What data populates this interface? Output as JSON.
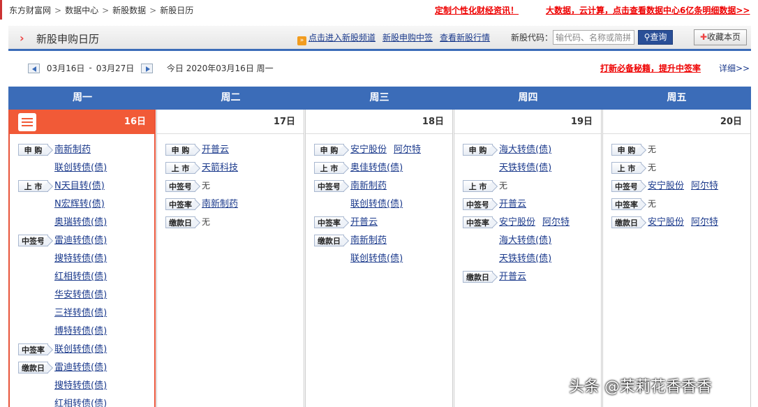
{
  "breadcrumb": [
    "东方财富网",
    "数据中心",
    "新股数据",
    "新股日历"
  ],
  "breadcrumb_sep": ">",
  "top_links": [
    "定制个性化财经资讯！",
    "大数据，云计算，点击查看数据中心6亿条明细数据>>"
  ],
  "header": {
    "title": "新股申购日历",
    "links": [
      "点击进入新股频道",
      "新股申购中签",
      "查看新股行情"
    ],
    "code_label": "新股代码：",
    "search_placeholder": "输代码、名称或简拼",
    "query_label": "查询",
    "favorite_label": "收藏本页"
  },
  "nav": {
    "range_start": "03月16日",
    "range_dash": "-",
    "range_end": "03月27日",
    "today_text": "今日 2020年03月16日 周一",
    "promo": "打新必备秘籍，提升中签率",
    "detail": "详细>>"
  },
  "colors": {
    "accent": "#3b6cb8",
    "today": "#f15a37",
    "alert": "#e00000"
  },
  "tag_labels": {
    "sg": "申 购",
    "ss": "上 市",
    "zqh": "中签号",
    "zql": "中签率",
    "jkr": "缴款日"
  },
  "none_text": "无",
  "days": [
    {
      "weekday": "周一",
      "date": "16日",
      "rows": [
        {
          "tag": "申 购",
          "items": [
            "南新制药"
          ]
        },
        {
          "tag": "",
          "items": [
            "联创转债(债)"
          ]
        },
        {
          "tag": "上 市",
          "items": [
            "N天目转(债)"
          ]
        },
        {
          "tag": "",
          "items": [
            "N宏辉转(债)"
          ]
        },
        {
          "tag": "",
          "items": [
            "奥瑞转债(债)"
          ]
        },
        {
          "tag": "中签号",
          "items": [
            "雷迪转债(债)"
          ]
        },
        {
          "tag": "",
          "items": [
            "搜特转债(债)"
          ]
        },
        {
          "tag": "",
          "items": [
            "红相转债(债)"
          ]
        },
        {
          "tag": "",
          "items": [
            "华安转债(债)"
          ]
        },
        {
          "tag": "",
          "items": [
            "三祥转债(债)"
          ]
        },
        {
          "tag": "",
          "items": [
            "博特转债(债)"
          ]
        },
        {
          "tag": "中签率",
          "items": [
            "联创转债(债)"
          ]
        },
        {
          "tag": "缴款日",
          "items": [
            "雷迪转债(债)"
          ]
        },
        {
          "tag": "",
          "items": [
            "搜特转债(债)"
          ]
        },
        {
          "tag": "",
          "items": [
            "红相转债(债)"
          ]
        }
      ]
    },
    {
      "weekday": "周二",
      "date": "17日",
      "rows": [
        {
          "tag": "申 购",
          "items": [
            "开普云"
          ]
        },
        {
          "tag": "上 市",
          "items": [
            "天箭科技"
          ]
        },
        {
          "tag": "中签号",
          "items": [],
          "none": true
        },
        {
          "tag": "中签率",
          "items": [
            "南新制药"
          ]
        },
        {
          "tag": "缴款日",
          "items": [],
          "none": true
        }
      ]
    },
    {
      "weekday": "周三",
      "date": "18日",
      "rows": [
        {
          "tag": "申 购",
          "items": [
            "安宁股份",
            "阿尔特"
          ]
        },
        {
          "tag": "上 市",
          "items": [
            "奥佳转债(债)"
          ]
        },
        {
          "tag": "中签号",
          "items": [
            "南新制药"
          ]
        },
        {
          "tag": "",
          "items": [
            "联创转债(债)"
          ]
        },
        {
          "tag": "中签率",
          "items": [
            "开普云"
          ]
        },
        {
          "tag": "缴款日",
          "items": [
            "南新制药"
          ]
        },
        {
          "tag": "",
          "items": [
            "联创转债(债)"
          ]
        }
      ]
    },
    {
      "weekday": "周四",
      "date": "19日",
      "rows": [
        {
          "tag": "申 购",
          "items": [
            "海大转债(债)"
          ]
        },
        {
          "tag": "",
          "items": [
            "天铁转债(债)"
          ]
        },
        {
          "tag": "上 市",
          "items": [],
          "none": true
        },
        {
          "tag": "中签号",
          "items": [
            "开普云"
          ]
        },
        {
          "tag": "中签率",
          "items": [
            "安宁股份",
            "阿尔特"
          ]
        },
        {
          "tag": "",
          "items": [
            "海大转债(债)"
          ]
        },
        {
          "tag": "",
          "items": [
            "天铁转债(债)"
          ]
        },
        {
          "tag": "缴款日",
          "items": [
            "开普云"
          ]
        }
      ]
    },
    {
      "weekday": "周五",
      "date": "20日",
      "rows": [
        {
          "tag": "申 购",
          "items": [],
          "none": true
        },
        {
          "tag": "上 市",
          "items": [],
          "none": true
        },
        {
          "tag": "中签号",
          "items": [
            "安宁股份",
            "阿尔特"
          ]
        },
        {
          "tag": "中签率",
          "items": [],
          "none": true
        },
        {
          "tag": "缴款日",
          "items": [
            "安宁股份",
            "阿尔特"
          ]
        }
      ]
    }
  ],
  "watermark": "头条 @茉莉花香香香"
}
